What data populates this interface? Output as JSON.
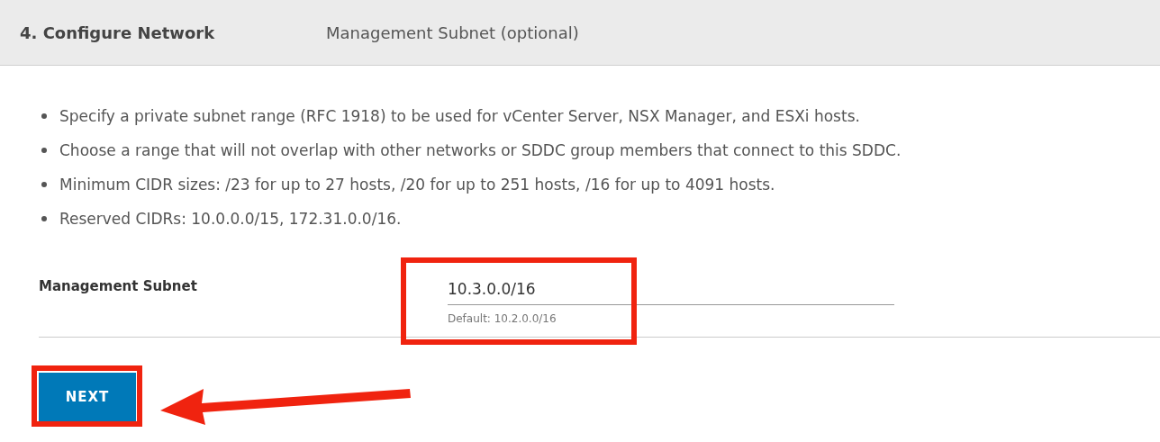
{
  "header": {
    "step": "4. Configure Network",
    "section": "Management Subnet (optional)"
  },
  "bullets": [
    "Specify a private subnet range (RFC 1918) to be used for vCenter Server, NSX Manager, and ESXi hosts.",
    "Choose a range that will not overlap with other networks or SDDC group members that connect to this SDDC.",
    "Minimum CIDR sizes: /23 for up to 27 hosts, /20 for up to 251 hosts, /16 for up to 4091 hosts.",
    "Reserved CIDRs: 10.0.0.0/15, 172.31.0.0/16."
  ],
  "field": {
    "label": "Management Subnet",
    "value": "10.3.0.0/16",
    "helper": "Default: 10.2.0.0/16"
  },
  "button": "NEXT"
}
